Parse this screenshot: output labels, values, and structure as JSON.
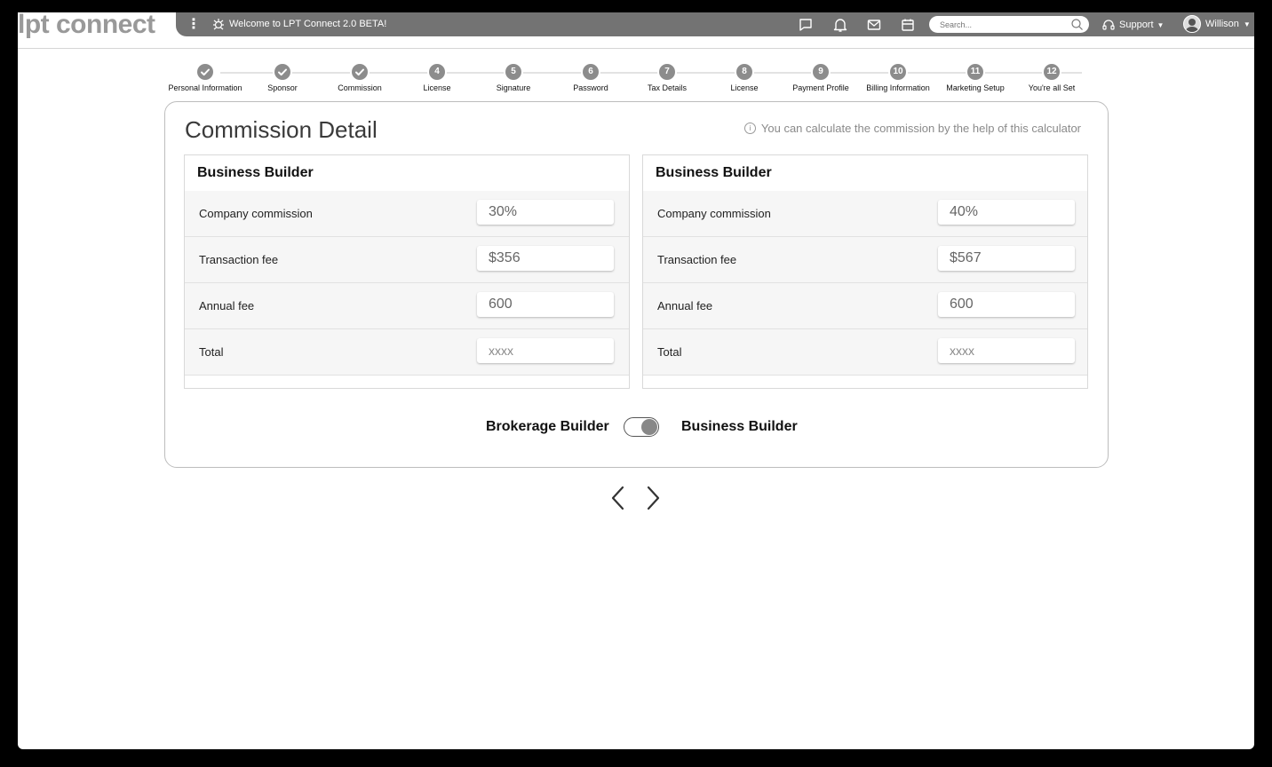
{
  "app": {
    "logo": "lpt connect",
    "welcome": "Welcome to LPT Connect 2.0 BETA!",
    "search_placeholder": "Search...",
    "support_label": "Support",
    "user_name": "Willison"
  },
  "steps": [
    {
      "num": "1",
      "label": "Personal Information",
      "done": true
    },
    {
      "num": "2",
      "label": "Sponsor",
      "done": true
    },
    {
      "num": "3",
      "label": "Commission",
      "done": true
    },
    {
      "num": "4",
      "label": "License",
      "done": false
    },
    {
      "num": "5",
      "label": "Signature",
      "done": false
    },
    {
      "num": "6",
      "label": "Password",
      "done": false
    },
    {
      "num": "7",
      "label": "Tax Details",
      "done": false
    },
    {
      "num": "8",
      "label": "License",
      "done": false
    },
    {
      "num": "9",
      "label": "Payment Profile",
      "done": false
    },
    {
      "num": "10",
      "label": "Billing Information",
      "done": false
    },
    {
      "num": "11",
      "label": "Marketing Setup",
      "done": false
    },
    {
      "num": "12",
      "label": "You're all Set",
      "done": false
    }
  ],
  "card": {
    "title": "Commission Detail",
    "hint": "You can calculate the commission by the help of this calculator"
  },
  "panels": [
    {
      "title": "Business Builder",
      "rows": [
        {
          "label": "Company commission",
          "value": "30%"
        },
        {
          "label": "Transaction fee",
          "value": "$356"
        },
        {
          "label": "Annual fee",
          "value": "600"
        },
        {
          "label": "Total",
          "placeholder": "xxxx"
        }
      ]
    },
    {
      "title": "Business Builder",
      "rows": [
        {
          "label": "Company commission",
          "value": "40%"
        },
        {
          "label": "Transaction fee",
          "value": "$567"
        },
        {
          "label": "Annual fee",
          "value": "600"
        },
        {
          "label": "Total",
          "placeholder": "xxxx"
        }
      ]
    }
  ],
  "toggle": {
    "left_label": "Brokerage Builder",
    "right_label": "Business Builder",
    "state": "right"
  }
}
